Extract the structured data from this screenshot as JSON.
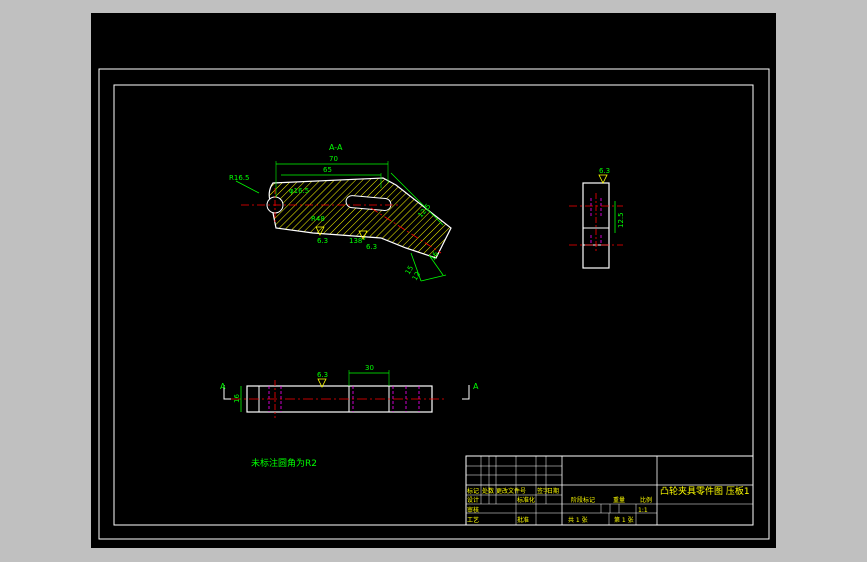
{
  "drawing": {
    "section_label": "A-A",
    "notes": "未标注圆角为R2",
    "part_name": "凸轮夹具零件图 压板1",
    "colors": {
      "background": "#000000",
      "border": "#ffffff",
      "dimension": "#00ff00",
      "centerline": "#ff0000",
      "hidden": "#ff00ff",
      "annotation": "#ffff00"
    }
  },
  "dims": {
    "d_r": "R16.5",
    "d_70": "70",
    "d_65": "65",
    "d_phi": "φ16.5",
    "d_r48": "R48",
    "d_63a": "6.3",
    "d_138": "138°",
    "d_63b": "6.3",
    "d_125": "12.5",
    "d_16": "16",
    "d_15": "15",
    "d_12": "12",
    "d_63side": "6.3",
    "d_12side": "12.5",
    "d_30": "30",
    "d_63bot": "6.3",
    "d_h": "16",
    "a_left": "A",
    "a_right": "A"
  },
  "title_block": {
    "row1": [
      "标记",
      "处数",
      "更改文件号",
      "签字",
      "日期"
    ],
    "designer": "设计",
    "std": "标准化",
    "check": "审核",
    "craft": "工艺",
    "approve": "批准",
    "stage": "阶段标记",
    "weight": "重量",
    "scale_label": "比例",
    "scale": "1:1",
    "total": "共 1 张",
    "sheet": "第 1 张"
  }
}
